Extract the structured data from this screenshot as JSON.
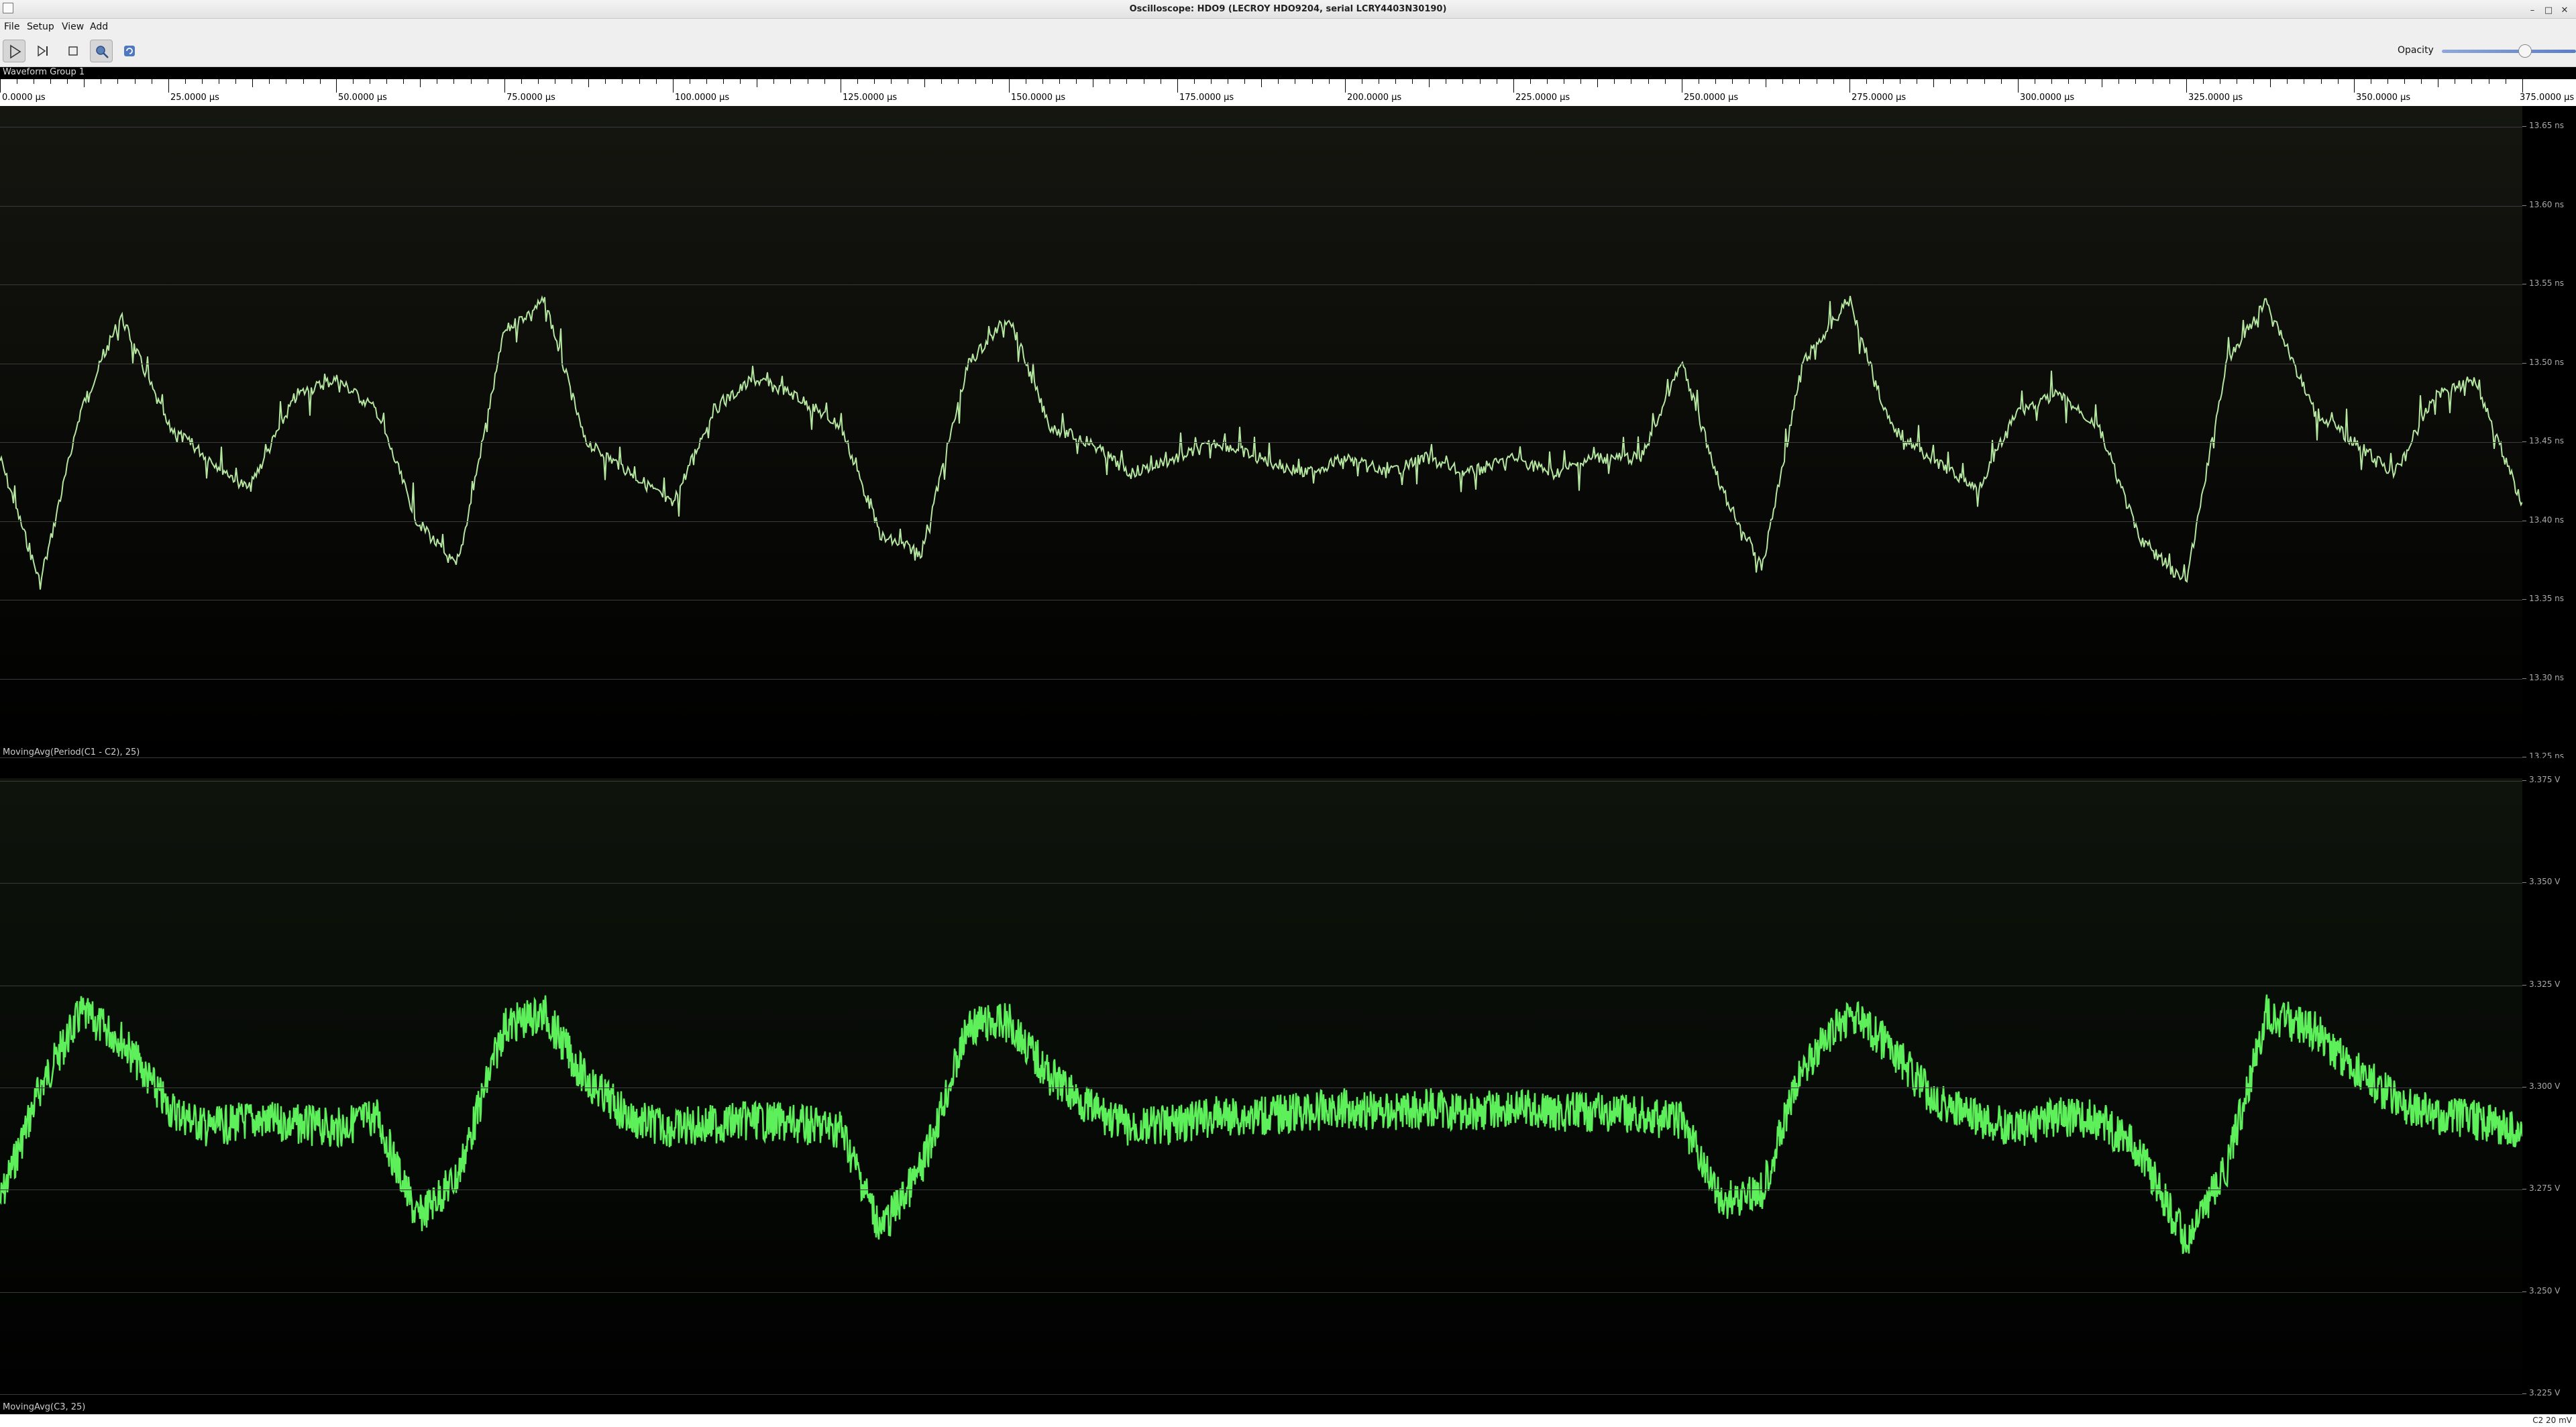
{
  "window": {
    "title": "Oscilloscope: HDO9 (LECROY HDO9204, serial LCRY4403N30190)"
  },
  "menu": {
    "items": [
      "File",
      "Setup",
      "View",
      "Add"
    ]
  },
  "toolbar": {
    "buttons": [
      {
        "icon": "play-icon",
        "active": true
      },
      {
        "icon": "step-icon",
        "active": false
      },
      {
        "icon": "stop-icon",
        "active": false
      },
      {
        "icon": "zoom-icon",
        "active": true
      },
      {
        "icon": "refresh-icon",
        "active": false
      }
    ],
    "opacity_label": "Opacity",
    "opacity_value": 0.62
  },
  "group": {
    "title": "Waveform Group 1"
  },
  "time_axis": {
    "labels": [
      "0.0000 µs",
      "25.0000 µs",
      "50.0000 µs",
      "75.0000 µs",
      "100.0000 µs",
      "125.0000 µs",
      "150.0000 µs",
      "175.0000 µs",
      "200.0000 µs",
      "225.0000 µs",
      "250.0000 µs",
      "275.0000 µs",
      "300.0000 µs",
      "325.0000 µs",
      "350.0000 µs",
      "375.0000 µs"
    ]
  },
  "plot1": {
    "label": "MovingAvg(Period(C1 - C2), 25)",
    "y_labels": [
      "13.65 ns",
      "13.60 ns",
      "13.55 ns",
      "13.50 ns",
      "13.45 ns",
      "13.40 ns",
      "13.35 ns",
      "13.30 ns",
      "13.25 ns"
    ],
    "color": "#b4e6a0"
  },
  "plot2": {
    "label": "MovingAvg(C3, 25)",
    "y_labels": [
      "3.375 V",
      "3.350 V",
      "3.325 V",
      "3.300 V",
      "3.275 V",
      "3.250 V",
      "3.225 V"
    ],
    "color": "#5ef05a"
  },
  "status": {
    "text": "C2 20 mV"
  },
  "chart_data": [
    {
      "type": "line",
      "title": "MovingAvg(Period(C1 - C2), 25)",
      "xlabel": "",
      "ylabel": "",
      "xlim": [
        0,
        375
      ],
      "ylim": [
        13.25,
        13.65
      ],
      "x": [
        0,
        6,
        12,
        18,
        25,
        31,
        37,
        44,
        50,
        56,
        62,
        68,
        75,
        81,
        87,
        94,
        100,
        106,
        112,
        118,
        125,
        131,
        137,
        144,
        150,
        156,
        162,
        168,
        175,
        181,
        187,
        194,
        200,
        206,
        212,
        218,
        225,
        231,
        237,
        244,
        250,
        256,
        262,
        268,
        275,
        281,
        287,
        294,
        300,
        306,
        312,
        318,
        325,
        331,
        337,
        344,
        350,
        356,
        362,
        368,
        375
      ],
      "y": [
        13.44,
        13.36,
        13.47,
        13.53,
        13.46,
        13.44,
        13.42,
        13.48,
        13.49,
        13.47,
        13.4,
        13.37,
        13.52,
        13.54,
        13.45,
        13.43,
        13.41,
        13.47,
        13.49,
        13.48,
        13.46,
        13.39,
        13.38,
        13.5,
        13.53,
        13.46,
        13.45,
        13.43,
        13.44,
        13.45,
        13.44,
        13.43,
        13.44,
        13.43,
        13.44,
        13.43,
        13.44,
        13.43,
        13.44,
        13.44,
        13.5,
        13.42,
        13.37,
        13.5,
        13.54,
        13.46,
        13.44,
        13.42,
        13.47,
        13.48,
        13.46,
        13.39,
        13.36,
        13.5,
        13.54,
        13.47,
        13.45,
        13.43,
        13.48,
        13.49,
        13.41
      ]
    },
    {
      "type": "line",
      "title": "MovingAvg(C3, 25)",
      "xlabel": "",
      "ylabel": "",
      "xlim": [
        0,
        375
      ],
      "ylim": [
        3.225,
        3.375
      ],
      "x": [
        0,
        6,
        12,
        18,
        25,
        31,
        37,
        44,
        50,
        56,
        62,
        68,
        75,
        81,
        87,
        94,
        100,
        106,
        112,
        118,
        125,
        131,
        137,
        144,
        150,
        156,
        162,
        168,
        175,
        181,
        187,
        194,
        200,
        206,
        212,
        218,
        225,
        231,
        237,
        244,
        250,
        256,
        262,
        268,
        275,
        281,
        287,
        294,
        300,
        306,
        312,
        318,
        325,
        331,
        337,
        344,
        350,
        356,
        362,
        368,
        375
      ],
      "y": [
        3.272,
        3.3,
        3.318,
        3.312,
        3.295,
        3.29,
        3.292,
        3.291,
        3.29,
        3.293,
        3.268,
        3.278,
        3.315,
        3.318,
        3.302,
        3.292,
        3.29,
        3.291,
        3.292,
        3.291,
        3.29,
        3.265,
        3.28,
        3.315,
        3.316,
        3.303,
        3.295,
        3.29,
        3.291,
        3.293,
        3.293,
        3.294,
        3.295,
        3.294,
        3.295,
        3.294,
        3.295,
        3.294,
        3.294,
        3.293,
        3.292,
        3.272,
        3.275,
        3.305,
        3.318,
        3.31,
        3.298,
        3.292,
        3.29,
        3.293,
        3.292,
        3.285,
        3.262,
        3.28,
        3.318,
        3.314,
        3.305,
        3.297,
        3.293,
        3.292,
        3.289
      ]
    }
  ]
}
